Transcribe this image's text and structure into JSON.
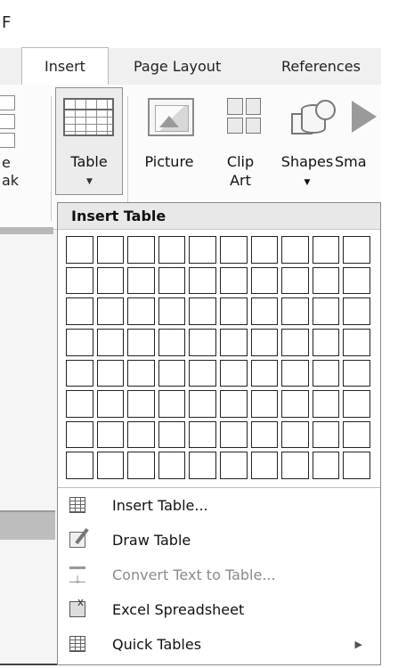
{
  "window": {
    "title_fragment": "F"
  },
  "tabs": {
    "insert": "Insert",
    "page_layout": "Page Layout",
    "references": "References"
  },
  "ribbon": {
    "page_break_partial": [
      "e",
      "ak"
    ],
    "table": "Table",
    "picture": "Picture",
    "clip_art": [
      "Clip",
      "Art"
    ],
    "shapes": "Shapes",
    "smartart_partial": "Sma"
  },
  "dropdown": {
    "header": "Insert Table",
    "grid": {
      "columns": 10,
      "rows": 8
    },
    "menu": [
      {
        "label": "Insert Table...",
        "icon": "table-icon",
        "enabled": true
      },
      {
        "label": "Draw Table",
        "icon": "draw-table-icon",
        "enabled": true
      },
      {
        "label": "Convert Text to Table...",
        "icon": "convert-text-icon",
        "enabled": false
      },
      {
        "label": "Excel Spreadsheet",
        "icon": "excel-icon",
        "enabled": true
      },
      {
        "label": "Quick Tables",
        "icon": "quick-tables-icon",
        "enabled": true,
        "submenu": true
      }
    ]
  }
}
